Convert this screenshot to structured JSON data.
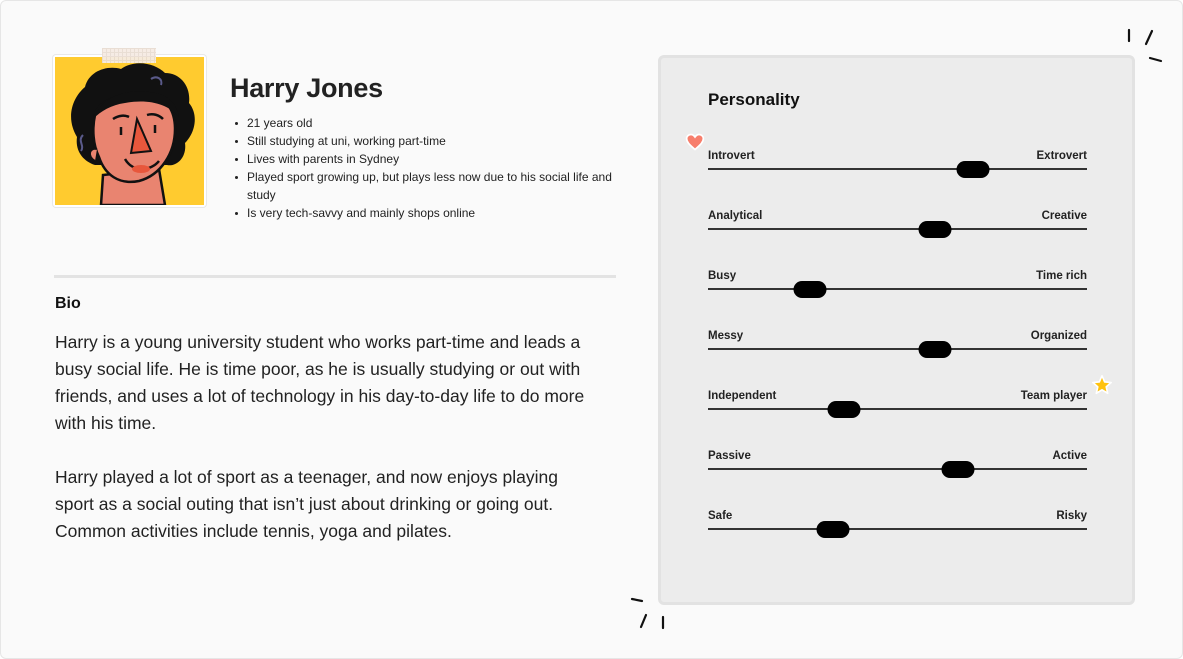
{
  "persona": {
    "name": "Harry Jones",
    "facts": [
      "21 years old",
      "Still studying at uni, working part-time",
      "Lives with parents in Sydney",
      "Played sport growing up, but plays less now due to his social life and study",
      "Is very tech-savvy and mainly shops online"
    ],
    "avatar_icon": "illustrated-portrait-curly-hair",
    "avatar_bg_color": "#ffcb2f"
  },
  "bio": {
    "title": "Bio",
    "paragraphs": [
      "Harry is a young university student who works part-time and leads a busy social life. He is time poor, as he is usually studying or out with friends, and uses a lot of technology in his day-to-day life to do more with his time.",
      "Harry played a lot of sport as a teenager, and now enjoys playing sport as a social outing that isn’t just about drinking or going out. Common activities include tennis, yoga and pilates."
    ]
  },
  "personality": {
    "title": "Personality",
    "traits": [
      {
        "left": "Introvert",
        "right": "Extrovert",
        "value": 0.7
      },
      {
        "left": "Analytical",
        "right": "Creative",
        "value": 0.6
      },
      {
        "left": "Busy",
        "right": "Time rich",
        "value": 0.27
      },
      {
        "left": "Messy",
        "right": "Organized",
        "value": 0.6
      },
      {
        "left": "Independent",
        "right": "Team player",
        "value": 0.36
      },
      {
        "left": "Passive",
        "right": "Active",
        "value": 0.66
      },
      {
        "left": "Safe",
        "right": "Risky",
        "value": 0.33
      }
    ],
    "stickers": [
      "heart-icon",
      "star-icon"
    ],
    "colors": {
      "heart": "#f77e6c",
      "star": "#ffc20e"
    }
  }
}
